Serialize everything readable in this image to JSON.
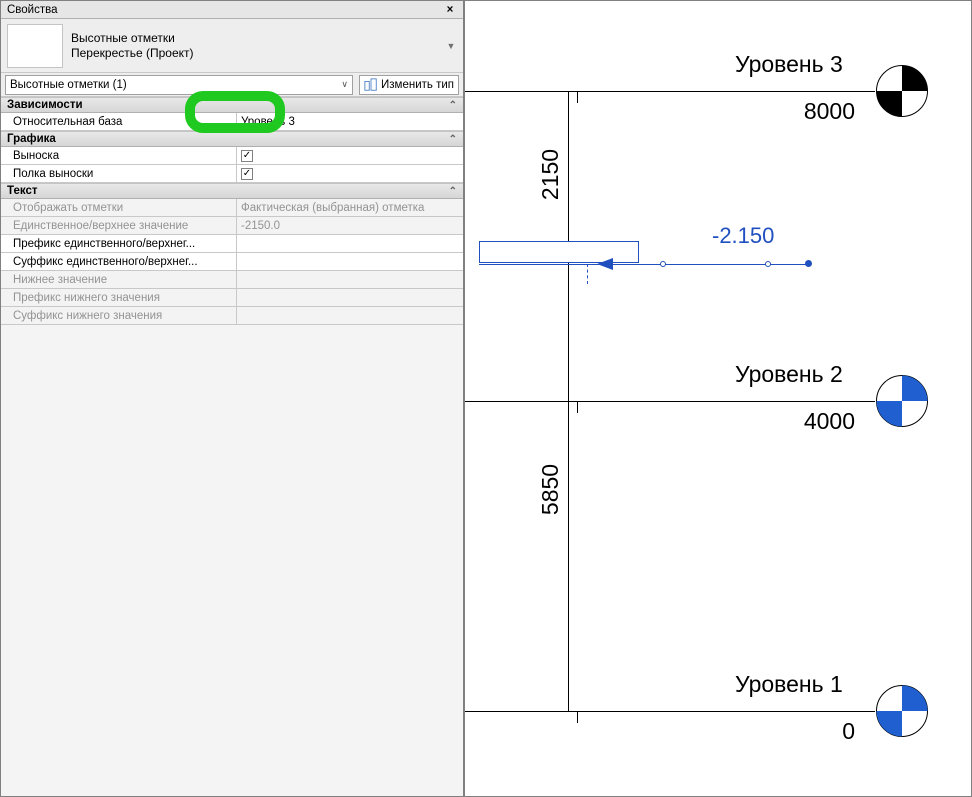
{
  "panel": {
    "title": "Свойства",
    "family_line1": "Высотные отметки",
    "family_line2": "Перекрестье (Проект)",
    "selector": "Высотные отметки (1)",
    "edit_type": "Изменить тип",
    "groups": {
      "dep": {
        "title": "Зависимости",
        "rows": {
          "rel_base": {
            "label": "Относительная база",
            "value": "Уровень 3"
          }
        }
      },
      "graph": {
        "title": "Графика",
        "rows": {
          "leader": {
            "label": "Выноска"
          },
          "shoulder": {
            "label": "Полка выноски"
          }
        }
      },
      "text": {
        "title": "Текст",
        "rows": {
          "display": {
            "label": "Отображать отметки",
            "value": "Фактическая (выбранная) отметка"
          },
          "single": {
            "label": "Единственное/верхнее значение",
            "value": "-2150.0"
          },
          "pref_single": {
            "label": "Префикс единственного/верхнег..."
          },
          "suf_single": {
            "label": "Суффикс единственного/верхнег..."
          },
          "lower": {
            "label": "Нижнее значение"
          },
          "pref_lower": {
            "label": "Префикс нижнего значения"
          },
          "suf_lower": {
            "label": "Суффикс нижнего значения"
          }
        }
      }
    }
  },
  "canvas": {
    "levels": [
      {
        "name": "Уровень 3",
        "value": "8000"
      },
      {
        "name": "Уровень 2",
        "value": "4000"
      },
      {
        "name": "Уровень 1",
        "value": "0"
      }
    ],
    "dims": [
      "2150",
      "5850"
    ],
    "spot": "-2.150"
  }
}
